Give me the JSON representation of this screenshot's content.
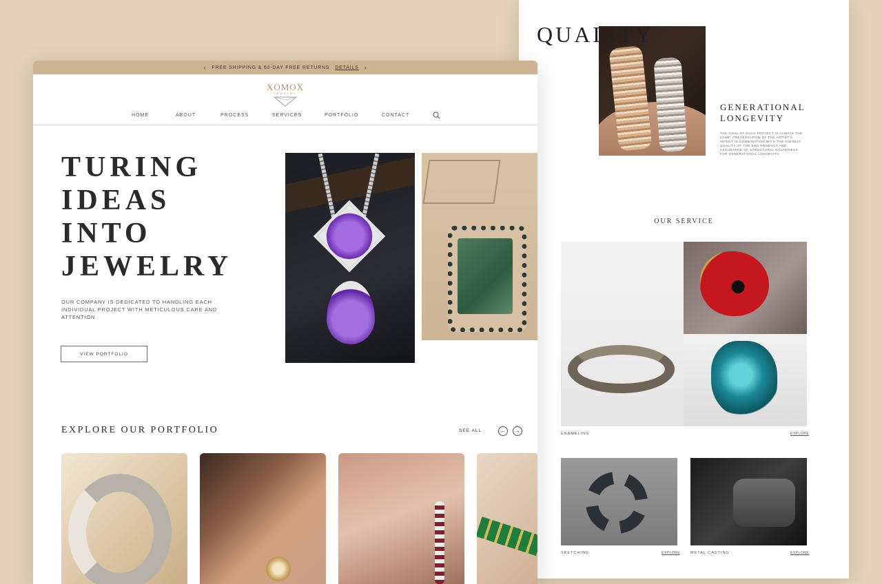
{
  "right_page": {
    "quality_title": "QUALITY",
    "generational": {
      "title": "GENERATIONAL LONGEVITY",
      "text": "The goal of each project is always the same: preservation of the artist's intent in combination with the highest quality of the end product and assurance of structural soundness for generational longevity."
    },
    "service": {
      "title": "OUR SERVICE",
      "items": [
        {
          "label": "ENAMELING",
          "link": "EXPLORE"
        },
        {
          "label": "SKETCHING",
          "link": "EXPLORE"
        },
        {
          "label": "METAL CASTING",
          "link": "EXPLORE"
        }
      ]
    }
  },
  "left_page": {
    "promo": {
      "text": "FREE SHIPPING & 60-DAY FREE RETURNS",
      "link": "DETAILS",
      "prev_icon": "chevron-left",
      "next_icon": "chevron-right"
    },
    "logo": {
      "word": "XOMOX",
      "sub": "JEWELRY"
    },
    "nav": [
      "HOME",
      "ABOUT",
      "PROCESS",
      "SERVICES",
      "PORTFOLIO",
      "CONTACT"
    ],
    "search_icon": "search",
    "hero": {
      "title_lines": [
        "TURING",
        "IDEAS",
        "INTO",
        "JEWELRY"
      ],
      "text": "OUR COMPANY IS DEDICATED TO HANDLING EACH INDIVIDUAL PROJECT WITH METICULOUS CARE AND ATTENTION",
      "button": "VIEW PORTFOLIO"
    },
    "portfolio": {
      "title": "EXPLORE OUR PORTFOLIO",
      "see_all": "SEE ALL",
      "prev_icon": "arrow-left",
      "next_icon": "arrow-right"
    }
  },
  "colors": {
    "background": "#e3d2b8",
    "promo_bar": "#cdb393",
    "logo_gold": "#b8905f",
    "text_dark": "#2a2a2a"
  }
}
